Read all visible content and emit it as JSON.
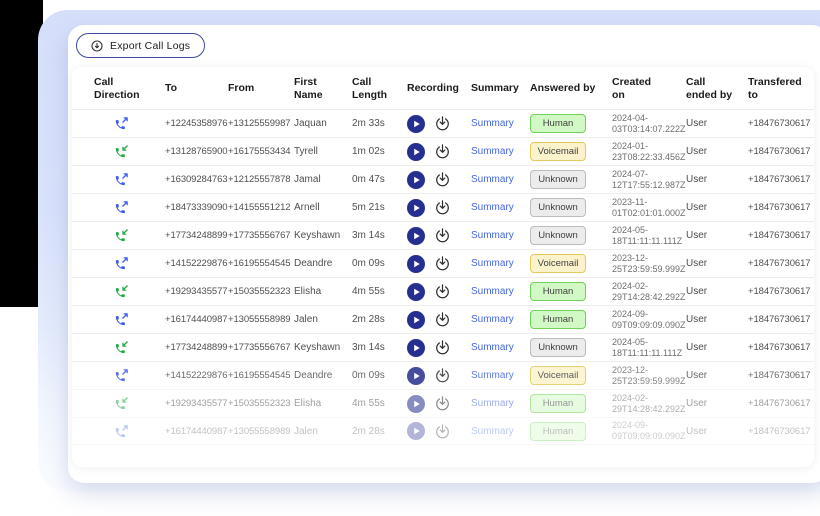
{
  "export_button": {
    "label": "Export Call Logs",
    "icon": "download-circle-icon"
  },
  "colors": {
    "background_blue": "#d9e2fb",
    "left_block": "#000000",
    "outbound_phone": "#3d5af1",
    "inbound_phone": "#27a847",
    "play_button": "#262f8f",
    "summary_link": "#4565e6",
    "export_border": "#3e4b9e",
    "badge_human_bg": "#d2f8c6",
    "badge_human_border": "#70d257",
    "badge_voicemail_bg": "#fcf3cc",
    "badge_voicemail_border": "#e5c95c",
    "badge_unknown_bg": "#ececec",
    "badge_unknown_border": "#bcbcbc"
  },
  "icons": {
    "export": "download-circle-icon",
    "recording_play": "play-circle-icon",
    "recording_download": "download-arrow-icon",
    "direction_outbound": "phone-outgoing-icon",
    "direction_inbound": "phone-incoming-icon"
  },
  "table": {
    "columns": [
      "Call\nDirection",
      "To",
      "From",
      "First\nName",
      "Call\nLength",
      "Recording",
      "Summary",
      "Answered by",
      "Created\non",
      "Call\nended by",
      "Transfered\nto"
    ],
    "summary_label": "Summary",
    "rows": [
      {
        "direction": "outbound",
        "to": "+12245358976",
        "from": "+13125559987",
        "first_name": "Jaquan",
        "call_length": "2m 33s",
        "answered_by": "Human",
        "created_on": "2024-04-03T03:14:07.222Z",
        "call_ended_by": "User",
        "transfered_to": "+18476730617",
        "opacity": 1
      },
      {
        "direction": "inbound",
        "to": "+13128765900",
        "from": "+16175553434",
        "first_name": "Tyrell",
        "call_length": "1m 02s",
        "answered_by": "Voicemail",
        "created_on": "2024-01-23T08:22:33.456Z",
        "call_ended_by": "User",
        "transfered_to": "+18476730617",
        "opacity": 1
      },
      {
        "direction": "outbound",
        "to": "+16309284763",
        "from": "+12125557878",
        "first_name": "Jamal",
        "call_length": "0m 47s",
        "answered_by": "Unknown",
        "created_on": "2024-07-12T17:55:12.987Z",
        "call_ended_by": "User",
        "transfered_to": "+18476730617",
        "opacity": 1
      },
      {
        "direction": "outbound",
        "to": "+18473339090",
        "from": "+14155551212",
        "first_name": "Arnell",
        "call_length": "5m 21s",
        "answered_by": "Unknown",
        "created_on": "2023-11-01T02:01:01.000Z",
        "call_ended_by": "User",
        "transfered_to": "+18476730617",
        "opacity": 1
      },
      {
        "direction": "inbound",
        "to": "+17734248899",
        "from": "+17735556767",
        "first_name": "Keyshawn",
        "call_length": "3m 14s",
        "answered_by": "Unknown",
        "created_on": "2024-05-18T11:11:11.111Z",
        "call_ended_by": "User",
        "transfered_to": "+18476730617",
        "opacity": 1
      },
      {
        "direction": "outbound",
        "to": "+14152229876",
        "from": "+16195554545",
        "first_name": "Deandre",
        "call_length": "0m 09s",
        "answered_by": "Voicemail",
        "created_on": "2023-12-25T23:59:59.999Z",
        "call_ended_by": "User",
        "transfered_to": "+18476730617",
        "opacity": 1
      },
      {
        "direction": "inbound",
        "to": "+19293435577",
        "from": "+15035552323",
        "first_name": "Elisha",
        "call_length": "4m 55s",
        "answered_by": "Human",
        "created_on": "2024-02-29T14:28:42.292Z",
        "call_ended_by": "User",
        "transfered_to": "+18476730617",
        "opacity": 1
      },
      {
        "direction": "outbound",
        "to": "+16174440987",
        "from": "+13055558989",
        "first_name": "Jalen",
        "call_length": "2m 28s",
        "answered_by": "Human",
        "created_on": "2024-09-09T09:09:09.090Z",
        "call_ended_by": "User",
        "transfered_to": "+18476730617",
        "opacity": 1
      },
      {
        "direction": "inbound",
        "to": "+17734248899",
        "from": "+17735556767",
        "first_name": "Keyshawn",
        "call_length": "3m 14s",
        "answered_by": "Unknown",
        "created_on": "2024-05-18T11:11:11.111Z",
        "call_ended_by": "User",
        "transfered_to": "+18476730617",
        "opacity": 1
      },
      {
        "direction": "outbound",
        "to": "+14152229876",
        "from": "+16195554545",
        "first_name": "Deandre",
        "call_length": "0m 09s",
        "answered_by": "Voicemail",
        "created_on": "2023-12-25T23:59:59.999Z",
        "call_ended_by": "User",
        "transfered_to": "+18476730617",
        "opacity": 0.85
      },
      {
        "direction": "inbound",
        "to": "+19293435577",
        "from": "+15035552323",
        "first_name": "Elisha",
        "call_length": "4m 55s",
        "answered_by": "Human",
        "created_on": "2024-02-29T14:28:42.292Z",
        "call_ended_by": "User",
        "transfered_to": "+18476730617",
        "opacity": 0.55
      },
      {
        "direction": "outbound",
        "to": "+16174440987",
        "from": "+13055558989",
        "first_name": "Jalen",
        "call_length": "2m 28s",
        "answered_by": "Human",
        "created_on": "2024-09-09T09:09:09.090Z",
        "call_ended_by": "User",
        "transfered_to": "+18476730617",
        "opacity": 0.35
      }
    ]
  }
}
